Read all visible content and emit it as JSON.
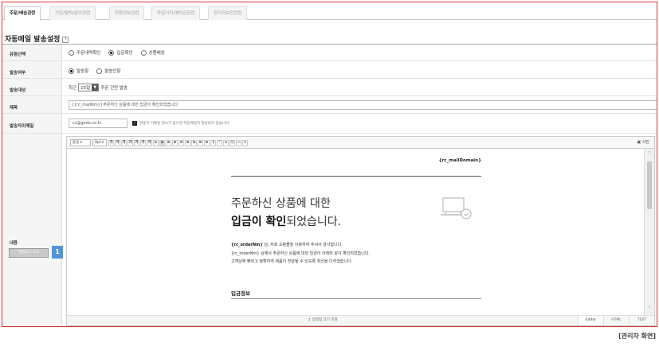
{
  "tabs": [
    {
      "label": "주문/배송관련",
      "active": true
    },
    {
      "label": "가입/탈퇴/문의관련",
      "active": false
    },
    {
      "label": "회원정보관련",
      "active": false
    },
    {
      "label": "마일리지/예치금관련",
      "active": false
    },
    {
      "label": "관리자보안관련",
      "active": false
    }
  ],
  "section": {
    "title": "자동메일 발송설정",
    "help": "?"
  },
  "rows": {
    "type": {
      "label": "유형선택",
      "options": [
        "주문내역확인",
        "입금확인",
        "상품배송"
      ],
      "selected": "입금확인"
    },
    "send": {
      "label": "발송여부",
      "options": [
        "발송함",
        "발송안함"
      ],
      "selected": "발송함"
    },
    "target": {
      "label": "발송대상",
      "prefix": "최근",
      "select_value": "15일",
      "suffix": "주문 건만 발송"
    },
    "subject": {
      "label": "제목",
      "value": "[{rc_mallNm}] 주문하신 상품에 대한 입금이 확인되었습니다."
    },
    "sender": {
      "label": "발송자이메일",
      "value": "cs@godo.co.kr",
      "note_icon": "!",
      "note": "발송자 이메일 정보가 없으면 자동메일이 발송되지 않습니다."
    },
    "content": {
      "label": "내용",
      "source_button": "치환코드 보기",
      "badge": "1"
    }
  },
  "editor": {
    "font_select": "돋움",
    "size_select": "9pt",
    "toolbar_glyphs": [
      "가",
      "가",
      "가",
      "가",
      "가",
      "가",
      "가",
      "x",
      "≡",
      "≡",
      "≡",
      "≡",
      "≡",
      "≡",
      "≡",
      "≡",
      "I",
      "\"",
      "∞",
      "☺",
      "▭",
      "⌕"
    ],
    "photo_label": "사진",
    "mail": {
      "domain": "{rc_mallDomain}",
      "headline_line1": "주문하신 상품에 대한",
      "headline_bold": "입금이 확인",
      "headline_rest": "되었습니다.",
      "line1_bold": "{rc_orderNm}",
      "line1_rest": " 님, 저희 쇼핑몰을 이용하여 주셔서 감사합니다.",
      "line2": "{rc_orderNm} 님께서 주문하신 상품에 대한 입금이 아래와 같이 확인되었습니다.",
      "line3": "고객님께 빠르고 정확하게 제품이 전달될 수 있도록 최선을 다하겠습니다.",
      "info_title": "입금정보"
    },
    "resize_label": "↕ 입력창 크기 조절",
    "modes": [
      {
        "label": "Editor",
        "active": true
      },
      {
        "label": "HTML",
        "active": false
      },
      {
        "label": "TEXT",
        "active": false
      }
    ]
  },
  "caption": "[관리자 화면]"
}
